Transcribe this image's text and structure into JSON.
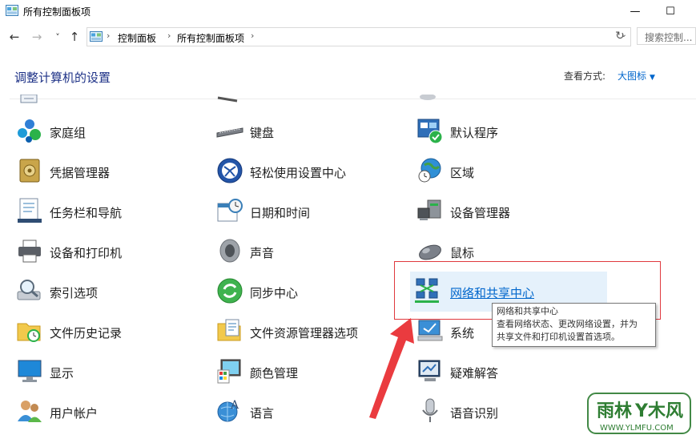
{
  "window": {
    "title": "所有控制面板项",
    "minimize": "—",
    "maximize": "☐"
  },
  "nav": {
    "back": "←",
    "forward": "→",
    "recent": "˅",
    "up": "↑",
    "breadcrumb": [
      "控制面板",
      "所有控制面板项"
    ],
    "refresh": "↻",
    "search_placeholder": "搜索控制..."
  },
  "header": {
    "title": "调整计算机的设置",
    "view_by_label": "查看方式:",
    "view_by_value": "大图标"
  },
  "items": {
    "col1": [
      "家庭组",
      "凭据管理器",
      "任务栏和导航",
      "设备和打印机",
      "索引选项",
      "文件历史记录",
      "显示",
      "用户帐户"
    ],
    "col2": [
      "键盘",
      "轻松使用设置中心",
      "日期和时间",
      "声音",
      "同步中心",
      "文件资源管理器选项",
      "颜色管理",
      "语言"
    ],
    "col3": [
      "默认程序",
      "区域",
      "设备管理器",
      "鼠标",
      "网络和共享中心",
      "系统",
      "疑难解答",
      "语音识别"
    ]
  },
  "tooltip": {
    "title": "网络和共享中心",
    "line1": "查看网络状态、更改网络设置，并为",
    "line2": "共享文件和打印机设置首选项。"
  },
  "watermark": {
    "brand": "雨林木风",
    "url": "WWW.YLMFU.COM"
  },
  "colors": {
    "accent": "#0066cc",
    "heading": "#1e3287",
    "highlight": "#e5f1fb",
    "annotation": "#e0393e"
  }
}
